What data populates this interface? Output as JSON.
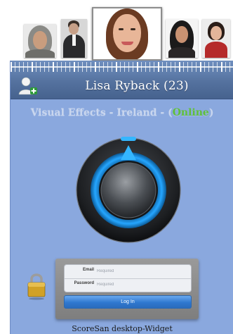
{
  "avatars": [
    {
      "name": "avatar-1",
      "selected": false
    },
    {
      "name": "avatar-2",
      "selected": false
    },
    {
      "name": "avatar-3",
      "selected": true
    },
    {
      "name": "avatar-4",
      "selected": false
    },
    {
      "name": "avatar-5",
      "selected": false
    }
  ],
  "header": {
    "title": "Lisa Ryback (23)",
    "add_user_icon": "add-user-icon"
  },
  "subtitle": {
    "prefix": "Visual Effects - Ireland - (",
    "status": "Online",
    "suffix": ")",
    "status_color": "#5fbf3a"
  },
  "dial": {
    "icon": "volume-knob-icon",
    "accent": "#34b6ff"
  },
  "login": {
    "email_label": "Email",
    "email_placeholder": "Required",
    "password_label": "Password",
    "password_placeholder": "Required",
    "button_label": "Log In",
    "lock_icon": "padlock-icon"
  },
  "footer": {
    "text": "ScoreSan desktop-Widget"
  },
  "colors": {
    "panel": "#8aa8de",
    "header": "#55729f",
    "button": "#2f78cf"
  }
}
